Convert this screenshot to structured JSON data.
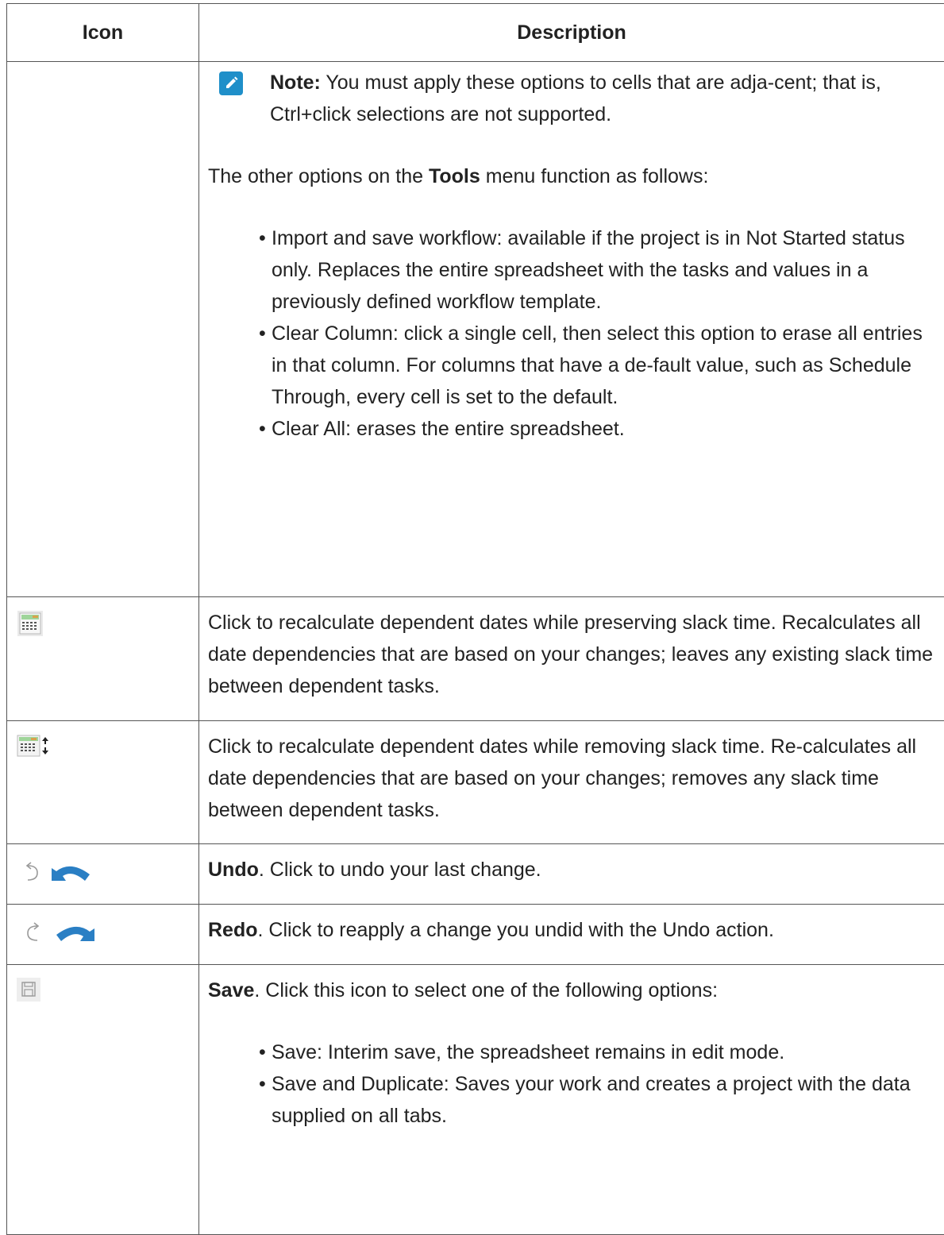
{
  "table": {
    "headers": {
      "icon": "Icon",
      "description": "Description"
    },
    "note": {
      "label": "Note:",
      "text": " You must apply these options to cells that are adja-cent; that is, Ctrl+click selections are not supported."
    },
    "tools_intro": {
      "before": "The other options on the ",
      "bold": "Tools",
      "after": " menu function as follows:"
    },
    "tools_items": [
      "Import and save workflow: available if the project is in Not Started status only. Replaces the entire spreadsheet with the tasks and values in a previously defined workflow template.",
      "Clear Column: click a single cell, then select this option to erase all entries in that column. For columns that have a de-fault value, such as Schedule Through, every cell is set to the default.",
      "Clear All: erases the entire spreadsheet."
    ],
    "rows": [
      {
        "icon": "calendar-recalc-preserve-icon",
        "text": "Click to recalculate dependent dates while preserving slack time. Recalculates all date dependencies that are based on your changes; leaves any existing slack time between dependent tasks."
      },
      {
        "icon": "calendar-recalc-remove-icon",
        "text": "Click to recalculate dependent dates while removing slack time. Re-calculates all date dependencies that are based on your changes; removes any slack time between dependent tasks."
      },
      {
        "icon": "undo-icon",
        "bold": "Undo",
        "text": ". Click to undo your last change."
      },
      {
        "icon": "redo-icon",
        "bold": "Redo",
        "text": ". Click to reapply a change you undid with the Undo action."
      },
      {
        "icon": "save-icon",
        "bold": "Save",
        "text": ". Click this icon to select one of the following options:"
      }
    ],
    "save_items": [
      "Save: Interim save, the spreadsheet remains in edit mode.",
      "Save and Duplicate: Saves your work and creates a project with the data supplied on all tabs."
    ],
    "bullet": "•"
  },
  "colors": {
    "note_badge": "#1f8fc9",
    "icon_blue": "#2a7fc4",
    "border": "#555555"
  }
}
